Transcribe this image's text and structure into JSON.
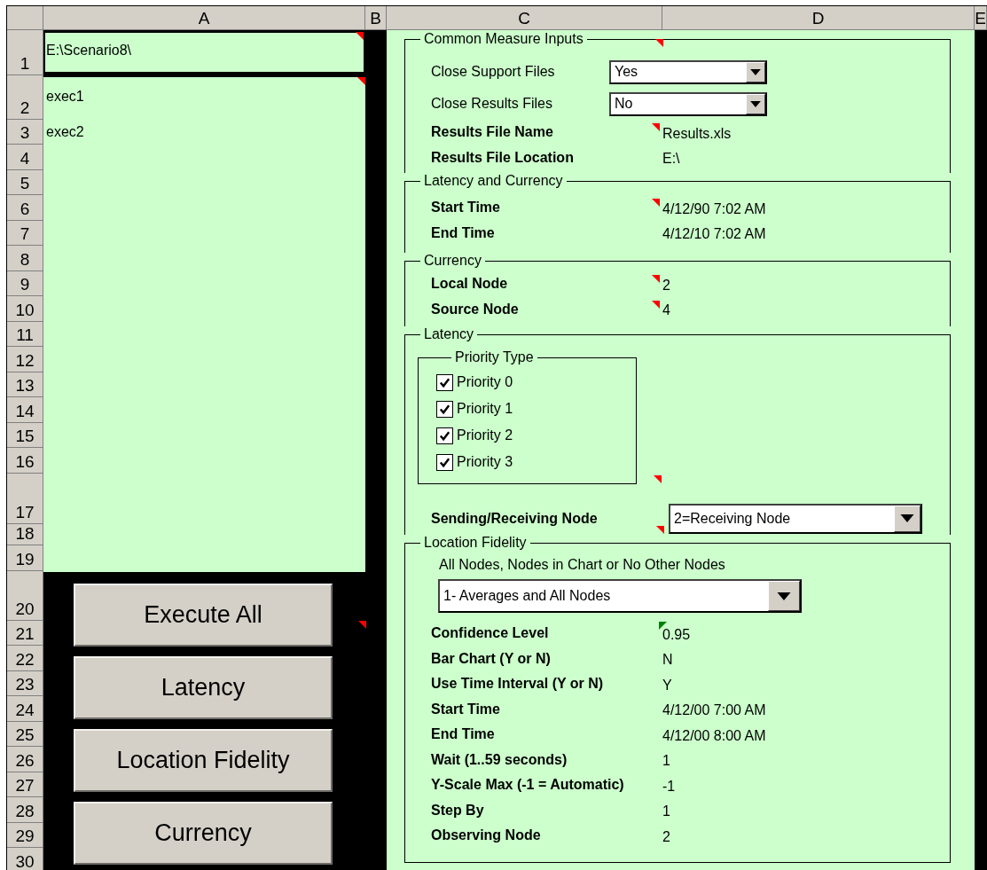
{
  "sheet": {
    "column_headers": [
      "A",
      "B",
      "C",
      "D",
      "E"
    ],
    "row_numbers": [
      "1",
      "2",
      "3",
      "4",
      "5",
      "6",
      "7",
      "8",
      "9",
      "10",
      "11",
      "12",
      "13",
      "14",
      "15",
      "16",
      "17",
      "18",
      "19",
      "20",
      "21",
      "22",
      "23",
      "24",
      "25",
      "26",
      "27",
      "28",
      "29",
      "30"
    ]
  },
  "column_a": {
    "path_cell": {
      "text": "E:\\Scenario8\\",
      "comment": true
    },
    "list": [
      {
        "text": "exec1",
        "comment": true
      },
      {
        "text": "exec2"
      }
    ]
  },
  "buttons": [
    {
      "label": "Execute All",
      "comment": true
    },
    {
      "label": "Latency"
    },
    {
      "label": "Location Fidelity"
    },
    {
      "label": "Currency"
    }
  ],
  "sections": [
    {
      "title": "Common Measure Inputs",
      "comment": true,
      "items": [
        {
          "kind": "combo",
          "label": "Close Support Files",
          "value": "Yes"
        },
        {
          "kind": "combo",
          "label": "Close Results Files",
          "value": "No"
        },
        {
          "kind": "field",
          "label": "Results File Name",
          "value": "Results.xls",
          "comment": true
        },
        {
          "kind": "field",
          "label": "Results File Location",
          "value": "E:\\"
        }
      ]
    },
    {
      "title": "Latency and Currency",
      "items": [
        {
          "kind": "field",
          "label": "Start Time",
          "value": "4/12/90 7:02 AM",
          "comment": true
        },
        {
          "kind": "field",
          "label": "End Time",
          "value": "4/12/10 7:02 AM"
        }
      ]
    },
    {
      "title": "Currency",
      "items": [
        {
          "kind": "field",
          "label": "Local Node",
          "value": "2",
          "comment": true
        },
        {
          "kind": "field",
          "label": "Source Node",
          "value": "4",
          "comment": true
        }
      ]
    },
    {
      "title": "Latency",
      "items": [
        {
          "kind": "checkgroup",
          "title": "Priority Type",
          "comment": true,
          "options": [
            {
              "label": "Priority 0",
              "checked": true
            },
            {
              "label": "Priority 1",
              "checked": true
            },
            {
              "label": "Priority 2",
              "checked": true
            },
            {
              "label": "Priority 3",
              "checked": true
            }
          ]
        },
        {
          "kind": "dropdown",
          "label": "Sending/Receiving Node",
          "value": "2=Receiving Node",
          "comment": true
        }
      ]
    },
    {
      "title": "Location Fidelity",
      "items": [
        {
          "kind": "caption",
          "text": "All Nodes, Nodes in Chart or No Other Nodes"
        },
        {
          "kind": "wide_dropdown",
          "value": "1- Averages and All Nodes"
        },
        {
          "kind": "field",
          "label": "Confidence Level",
          "value": "0.95",
          "error": true
        },
        {
          "kind": "field",
          "label": "Bar Chart (Y or N)",
          "value": "N"
        },
        {
          "kind": "field",
          "label": "Use Time Interval (Y or N)",
          "value": "Y"
        },
        {
          "kind": "field",
          "label": "Start Time",
          "value": "4/12/00 7:00 AM"
        },
        {
          "kind": "field",
          "label": "End Time",
          "value": "4/12/00 8:00 AM"
        },
        {
          "kind": "field",
          "label": "Wait (1..59 seconds)",
          "value": "1"
        },
        {
          "kind": "field",
          "label": "Y-Scale Max (-1 = Automatic)",
          "value": "-1"
        },
        {
          "kind": "field",
          "label": "Step By",
          "value": "1"
        },
        {
          "kind": "field",
          "label": "Observing Node",
          "value": "2"
        }
      ]
    }
  ]
}
